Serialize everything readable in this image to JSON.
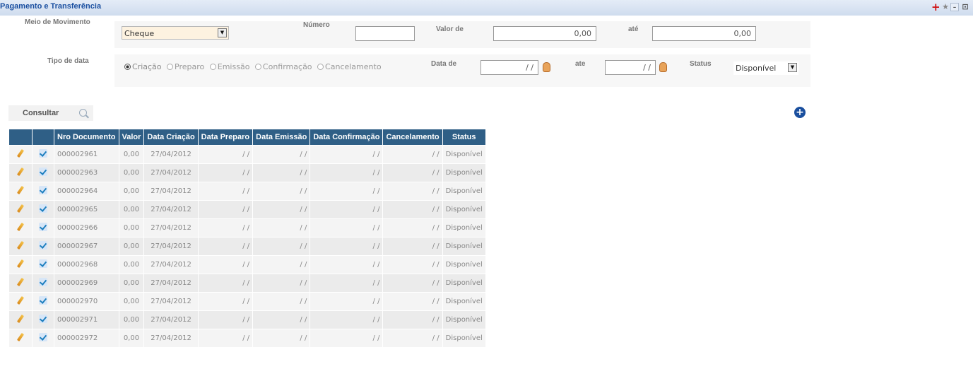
{
  "window": {
    "title": "Pagamento e Transferência"
  },
  "filters": {
    "meio_label": "Meio de Movimento",
    "meio_value": "Cheque",
    "numero_label": "Número",
    "numero_value": "",
    "valor_de_label": "Valor de",
    "valor_de_value": "0,00",
    "valor_ate_label": "até",
    "valor_ate_value": "0,00",
    "tipo_data_label": "Tipo de data",
    "tipo_data_options": [
      "Criação",
      "Preparo",
      "Emissão",
      "Confirmação",
      "Cancelamento"
    ],
    "tipo_data_selected": "Criação",
    "data_de_label": "Data de",
    "data_de_value": "/ /",
    "data_ate_label": "ate",
    "data_ate_value": "/ /",
    "status_label": "Status",
    "status_value": "Disponível"
  },
  "actions": {
    "consultar_label": "Consultar"
  },
  "table": {
    "headers": [
      "",
      "",
      "Nro Documento",
      "Valor",
      "Data Criação",
      "Data Preparo",
      "Data Emissão",
      "Data Confirmação",
      "Cancelamento",
      "Status"
    ],
    "rows": [
      {
        "doc": "000002961",
        "valor": "0,00",
        "criacao": "27/04/2012",
        "preparo": "/ /",
        "emissao": "/ /",
        "confirmacao": "/ /",
        "cancelamento": "/ /",
        "status": "Disponível"
      },
      {
        "doc": "000002963",
        "valor": "0,00",
        "criacao": "27/04/2012",
        "preparo": "/ /",
        "emissao": "/ /",
        "confirmacao": "/ /",
        "cancelamento": "/ /",
        "status": "Disponível"
      },
      {
        "doc": "000002964",
        "valor": "0,00",
        "criacao": "27/04/2012",
        "preparo": "/ /",
        "emissao": "/ /",
        "confirmacao": "/ /",
        "cancelamento": "/ /",
        "status": "Disponível"
      },
      {
        "doc": "000002965",
        "valor": "0,00",
        "criacao": "27/04/2012",
        "preparo": "/ /",
        "emissao": "/ /",
        "confirmacao": "/ /",
        "cancelamento": "/ /",
        "status": "Disponível"
      },
      {
        "doc": "000002966",
        "valor": "0,00",
        "criacao": "27/04/2012",
        "preparo": "/ /",
        "emissao": "/ /",
        "confirmacao": "/ /",
        "cancelamento": "/ /",
        "status": "Disponível"
      },
      {
        "doc": "000002967",
        "valor": "0,00",
        "criacao": "27/04/2012",
        "preparo": "/ /",
        "emissao": "/ /",
        "confirmacao": "/ /",
        "cancelamento": "/ /",
        "status": "Disponível"
      },
      {
        "doc": "000002968",
        "valor": "0,00",
        "criacao": "27/04/2012",
        "preparo": "/ /",
        "emissao": "/ /",
        "confirmacao": "/ /",
        "cancelamento": "/ /",
        "status": "Disponível"
      },
      {
        "doc": "000002969",
        "valor": "0,00",
        "criacao": "27/04/2012",
        "preparo": "/ /",
        "emissao": "/ /",
        "confirmacao": "/ /",
        "cancelamento": "/ /",
        "status": "Disponível"
      },
      {
        "doc": "000002970",
        "valor": "0,00",
        "criacao": "27/04/2012",
        "preparo": "/ /",
        "emissao": "/ /",
        "confirmacao": "/ /",
        "cancelamento": "/ /",
        "status": "Disponível"
      },
      {
        "doc": "000002971",
        "valor": "0,00",
        "criacao": "27/04/2012",
        "preparo": "/ /",
        "emissao": "/ /",
        "confirmacao": "/ /",
        "cancelamento": "/ /",
        "status": "Disponível"
      },
      {
        "doc": "000002972",
        "valor": "0,00",
        "criacao": "27/04/2012",
        "preparo": "/ /",
        "emissao": "/ /",
        "confirmacao": "/ /",
        "cancelamento": "/ /",
        "status": "Disponível"
      }
    ]
  },
  "icons": {
    "edit": "pencil-icon",
    "confirm": "check-icon",
    "search": "search-icon",
    "add": "add-circle-icon",
    "calendar": "calendar-icon"
  },
  "colors": {
    "header_bg": "#2f5f86",
    "title": "#1a4fa0",
    "titlebar": "#cfdcee",
    "add_button": "#1a4f9e"
  }
}
